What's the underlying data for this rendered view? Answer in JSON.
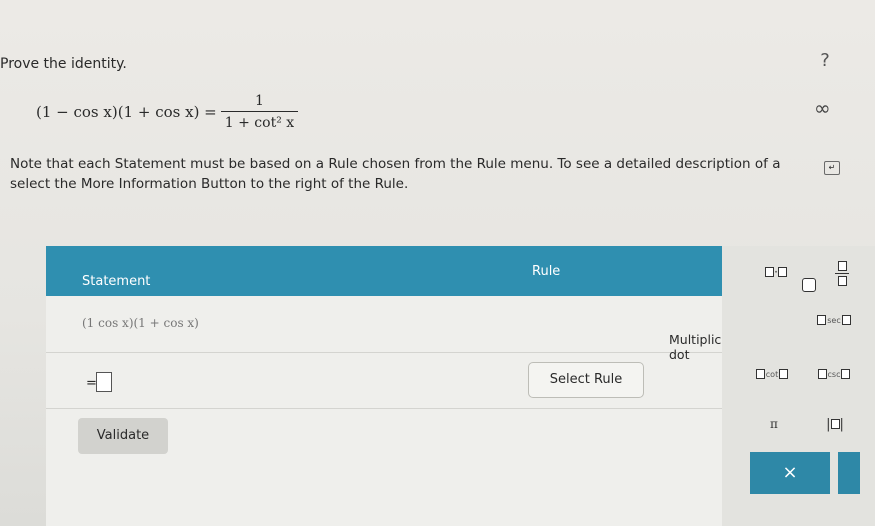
{
  "prompt": "Prove the identity.",
  "identity": {
    "lhs": "(1 − cos x)(1 + cos x) =",
    "numerator": "1",
    "denominator": "1 + cot² x"
  },
  "note": {
    "line1": "Note that each Statement must be based on a Rule chosen from the Rule menu. To see a detailed description of a",
    "line2": "select the More Information Button to the right of the Rule."
  },
  "table": {
    "statement_header": "Statement",
    "rule_header": "Rule",
    "row1_statement": "(1  cos x)(1 + cos x)",
    "row2_prefix": "=",
    "select_rule_label": "Select Rule",
    "validate_label": "Validate"
  },
  "palette": {
    "multiplication_tooltip": "Multiplication dot",
    "sec_label": "sec",
    "cot_label": "cot",
    "csc_label": "csc",
    "pi_label": "π",
    "abs_label": "( )",
    "close_label": "×"
  },
  "colors": {
    "header": "#2f8fb0",
    "button": "#2e88a7"
  }
}
